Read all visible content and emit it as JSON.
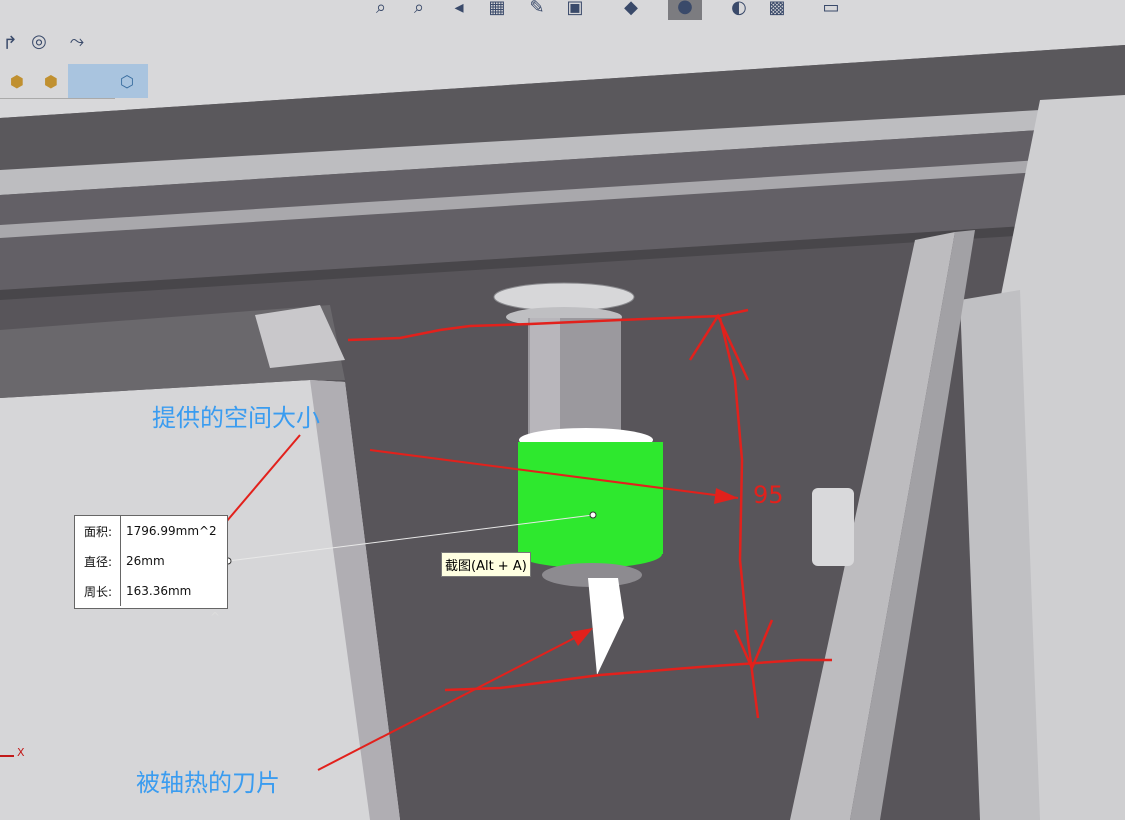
{
  "toolbar": {
    "icons": [
      "redo-icon",
      "target-icon",
      "sketch-smart-dimension-icon"
    ],
    "top_icons": [
      "zoom-to-fit-icon",
      "zoom-area-icon",
      "previous-view-icon",
      "section-view-icon",
      "dynamic-annotation-icon",
      "view-orientation-icon",
      "display-style-icon",
      "hide-show-icon",
      "edit-appearance-icon",
      "apply-scene-icon",
      "view-settings-icon"
    ]
  },
  "breadcrumb": {
    "items": [
      "assembly-icon",
      "subassembly-icon",
      "part-icon"
    ]
  },
  "measure": {
    "rows": [
      {
        "key": "面积:",
        "value": "1796.99mm^2"
      },
      {
        "key": "直径:",
        "value": "26mm"
      },
      {
        "key": "周长:",
        "value": "163.36mm"
      }
    ],
    "caret": "^"
  },
  "tooltip": {
    "text": "截图(Alt + A)"
  },
  "annotations": {
    "space_label": "提供的空间大小",
    "blade_label": "被轴热的刀片",
    "dimension_value": "95"
  },
  "triad": {
    "x_label": "X"
  },
  "colors": {
    "annotation_blue": "#3a9cf0",
    "annotation_red": "#e2211c",
    "highlight_green": "#2ee82e",
    "viewport_dark": "#58555a"
  }
}
